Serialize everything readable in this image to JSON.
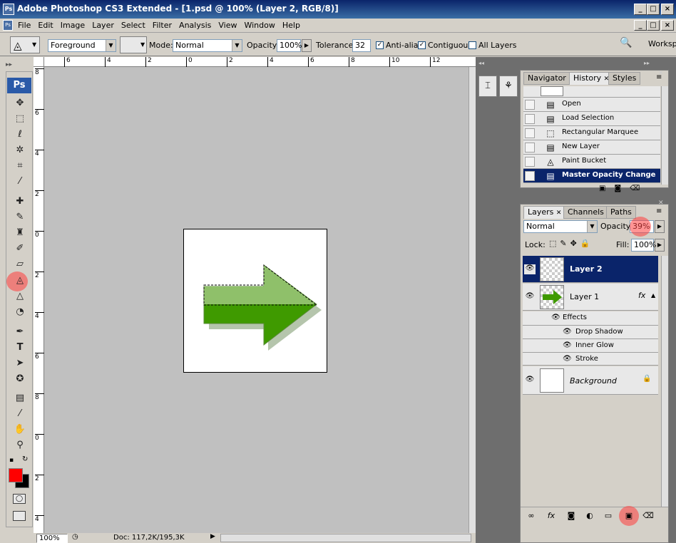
{
  "window": {
    "title": "Adobe Photoshop CS3 Extended - [1.psd @ 100% (Layer 2, RGB/8)]",
    "app_icon": "Ps",
    "controls": [
      "_",
      "□",
      "×"
    ],
    "doc_controls": [
      "_",
      "□",
      "×"
    ]
  },
  "menu": [
    "File",
    "Edit",
    "Image",
    "Layer",
    "Select",
    "Filter",
    "Analysis",
    "View",
    "Window",
    "Help"
  ],
  "options": {
    "fill_source": "Foreground",
    "mode_label": "Mode:",
    "mode_value": "Normal",
    "opacity_label": "Opacity:",
    "opacity_value": "100%",
    "tolerance_label": "Tolerance:",
    "tolerance_value": "32",
    "antialias_label": "Anti-alias",
    "contiguous_label": "Contiguous",
    "all_layers_label": "All Layers",
    "workspace_label": "Worksp"
  },
  "toolbox": {
    "logo": "Ps",
    "foreground_color": "#ff0000",
    "background_color": "#000000"
  },
  "rulers": {
    "h_ticks": [
      "6",
      "4",
      "2",
      "0",
      "2",
      "4",
      "6",
      "8",
      "10",
      "12"
    ],
    "v_ticks": [
      "8",
      "6",
      "4",
      "2",
      "0",
      "2",
      "4",
      "6",
      "8",
      "0",
      "2",
      "4"
    ]
  },
  "status": {
    "zoom": "100%",
    "doc": "Doc: 117,2K/195,3K"
  },
  "history_panel": {
    "tabs": [
      "Navigator",
      "History",
      "Styles"
    ],
    "active_tab": "History",
    "items": [
      {
        "label": "Open",
        "icon": "document-icon"
      },
      {
        "label": "Load Selection",
        "icon": "document-icon"
      },
      {
        "label": "Rectangular Marquee",
        "icon": "marquee-icon"
      },
      {
        "label": "New Layer",
        "icon": "document-icon"
      },
      {
        "label": "Paint Bucket",
        "icon": "paint-bucket-icon"
      },
      {
        "label": "Master Opacity Change",
        "icon": "document-icon"
      }
    ],
    "selected_index": 5
  },
  "layers_panel": {
    "tabs": [
      "Layers",
      "Channels",
      "Paths"
    ],
    "active_tab": "Layers",
    "blend_mode": "Normal",
    "opacity_label": "Opacity:",
    "opacity_value": "39%",
    "lock_label": "Lock:",
    "fill_label": "Fill:",
    "fill_value": "100%",
    "layers": [
      {
        "name": "Layer 2",
        "selected": true
      },
      {
        "name": "Layer 1",
        "selected": false,
        "fx": "fx"
      },
      {
        "name": "Background",
        "selected": false
      }
    ],
    "effects_label": "Effects",
    "effects": [
      "Drop Shadow",
      "Inner Glow",
      "Stroke"
    ]
  },
  "colors": {
    "selection": "#0a246a",
    "arrow_light": "#8fc06a",
    "arrow_dark": "#3f9a00",
    "highlight": "#ff3c3c"
  }
}
